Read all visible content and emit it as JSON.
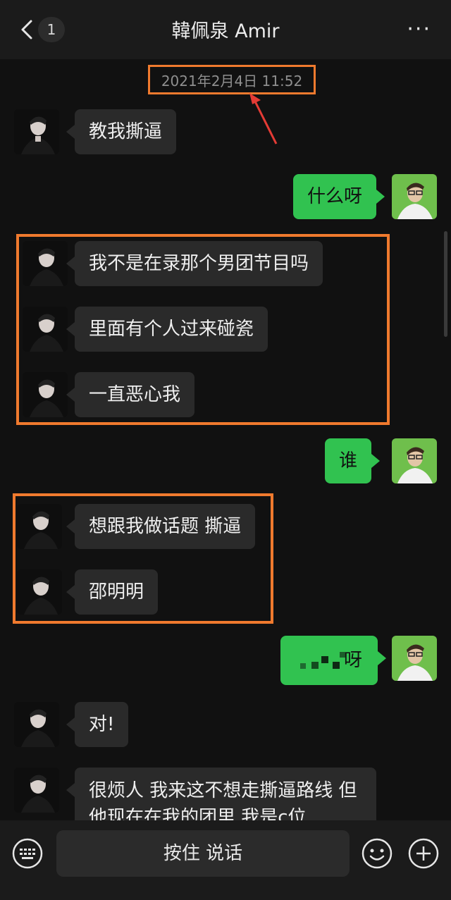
{
  "header": {
    "title": "韓佩泉 Amir",
    "unread_count": "1",
    "more": "···"
  },
  "timestamp": "2021年2月4日 11:52",
  "messages": [
    {
      "side": "left",
      "text": "教我撕逼"
    },
    {
      "side": "right",
      "text": "什么呀"
    },
    {
      "side": "left",
      "text": "我不是在录那个男团节目吗"
    },
    {
      "side": "left",
      "text": "里面有个人过来碰瓷"
    },
    {
      "side": "left",
      "text": "一直恶心我"
    },
    {
      "side": "right",
      "text": "谁"
    },
    {
      "side": "left",
      "text": "想跟我做话题 撕逼"
    },
    {
      "side": "left",
      "text": "邵明明"
    },
    {
      "side": "right",
      "text": "呀"
    },
    {
      "side": "left",
      "text": "对!"
    },
    {
      "side": "left",
      "text": "很烦人 我来这不想走撕逼路线 但\n他现在在我的团里 我是c位"
    }
  ],
  "input": {
    "hold_to_talk": "按住 说话"
  },
  "colors": {
    "accent_green": "#31c250",
    "highlight_orange": "#f07a2e",
    "background": "#111111"
  },
  "icons": [
    "back-chevron-icon",
    "more-icon",
    "keyboard-icon",
    "emoji-icon",
    "plus-icon"
  ]
}
